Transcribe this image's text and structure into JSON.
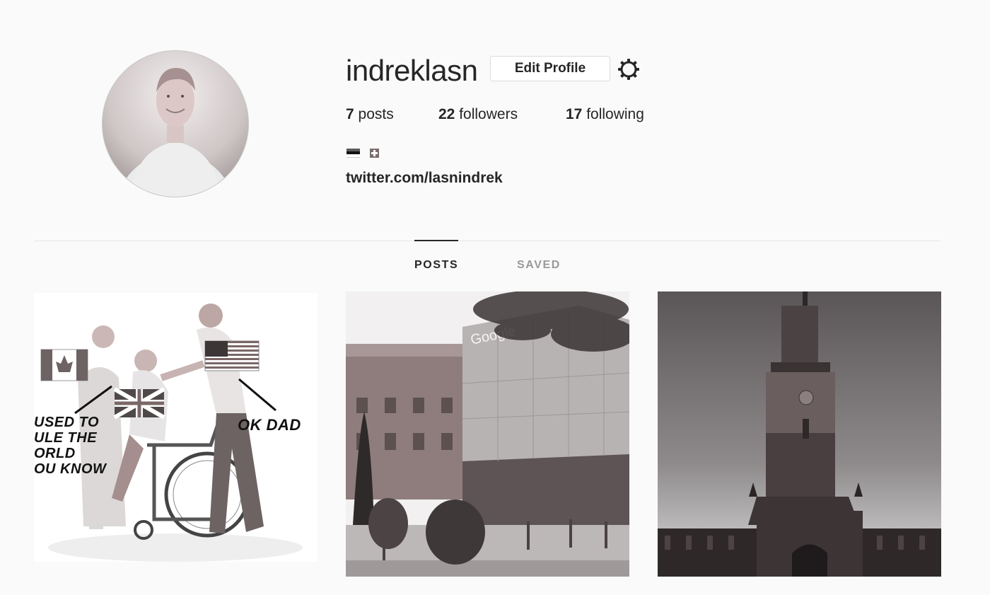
{
  "profile": {
    "username": "indreklasn",
    "edit_label": "Edit Profile",
    "link": "twitter.com/lasnindrek",
    "bio_flags": [
      "estonia-flag-icon",
      "switzerland-flag-icon"
    ]
  },
  "stats": {
    "posts_count": "7",
    "posts_label": "posts",
    "followers_count": "22",
    "followers_label": "followers",
    "following_count": "17",
    "following_label": "following"
  },
  "tabs": [
    {
      "label": "POSTS",
      "active": true
    },
    {
      "label": "SAVED",
      "active": false
    }
  ],
  "posts": [
    {
      "kind": "meme",
      "left_caption": "USED TO\nULE THE\nORLD\nOU KNOW",
      "right_caption": "OK DAD"
    },
    {
      "kind": "photo",
      "subject": "building-with-sign",
      "sign_text": "Google"
    },
    {
      "kind": "photo",
      "subject": "clock-tower"
    }
  ],
  "colors": {
    "text": "#262626",
    "muted": "#999999",
    "border": "#dbdbdb",
    "background": "#fafafa"
  }
}
